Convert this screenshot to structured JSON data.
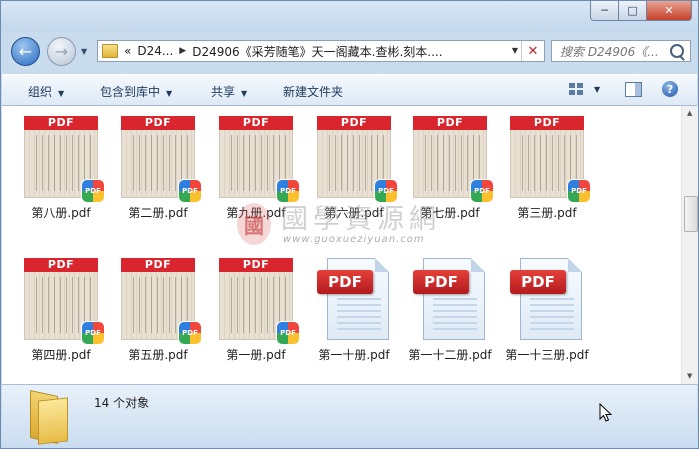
{
  "window": {
    "caption_buttons": [
      "minimize",
      "maximize",
      "close"
    ]
  },
  "navigation": {
    "address": {
      "overflow": "«",
      "crumbs": [
        "D24...",
        "D24906《采芳随笔》天一阁藏本.查彬.刻本...."
      ]
    },
    "search_placeholder": "搜索 D24906《..."
  },
  "toolbar": {
    "organize": "组织",
    "include_in_library": "包含到库中",
    "share": "共享",
    "new_folder": "新建文件夹"
  },
  "files": [
    {
      "name": "第八册.pdf",
      "icon": "pdf-scan-thumbnail"
    },
    {
      "name": "第二册.pdf",
      "icon": "pdf-scan-thumbnail"
    },
    {
      "name": "第九册.pdf",
      "icon": "pdf-scan-thumbnail"
    },
    {
      "name": "第六册.pdf",
      "icon": "pdf-scan-thumbnail"
    },
    {
      "name": "第七册.pdf",
      "icon": "pdf-scan-thumbnail"
    },
    {
      "name": "第三册.pdf",
      "icon": "pdf-scan-thumbnail"
    },
    {
      "name": "第四册.pdf",
      "icon": "pdf-scan-thumbnail"
    },
    {
      "name": "第五册.pdf",
      "icon": "pdf-scan-thumbnail"
    },
    {
      "name": "第一册.pdf",
      "icon": "pdf-scan-thumbnail"
    },
    {
      "name": "第一十册.pdf",
      "icon": "pdf-document-icon"
    },
    {
      "name": "第一十二册.pdf",
      "icon": "pdf-document-icon"
    },
    {
      "name": "第一十三册.pdf",
      "icon": "pdf-document-icon"
    }
  ],
  "thumbnail_banner": "PDF",
  "badge_text": "PDF",
  "watermark": {
    "seal": "國",
    "title": "國學資源網",
    "url": "www.guoxueziyuan.com"
  },
  "status": {
    "count_text": "14 个对象"
  },
  "colors": {
    "pdf_red": "#d9262e",
    "chrome_blue": "#c9dced",
    "toolbar_text": "#1e395b"
  }
}
